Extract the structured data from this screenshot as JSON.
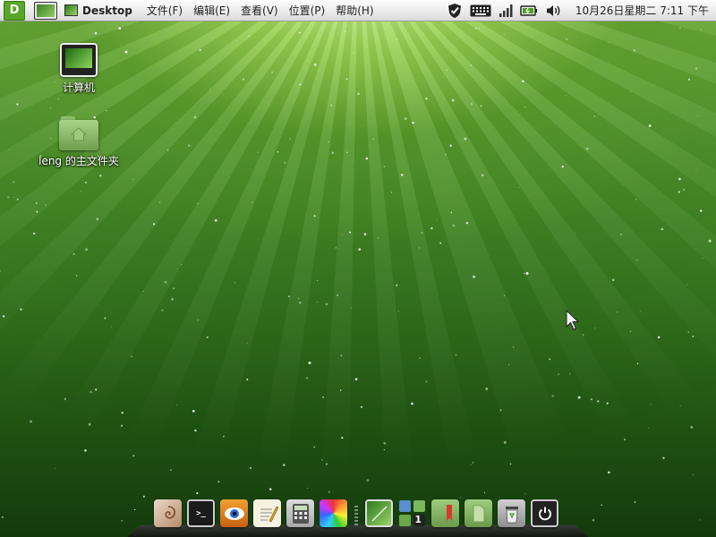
{
  "panel": {
    "logo_text": "D",
    "app_title": "Desktop",
    "menu": [
      {
        "label": "文件(F)"
      },
      {
        "label": "编辑(E)"
      },
      {
        "label": "查看(V)"
      },
      {
        "label": "位置(P)"
      },
      {
        "label": "帮助(H)"
      }
    ],
    "tray_icons": [
      "security-shield-icon",
      "keyboard-icon",
      "network-signal-icon",
      "battery-icon",
      "volume-icon"
    ],
    "clock": "10月26日星期二  7:11 下午"
  },
  "desktop": {
    "icons": [
      {
        "label": "计算机",
        "icon": "computer-icon"
      },
      {
        "label": "leng 的主文件夹",
        "icon": "home-folder-icon"
      }
    ]
  },
  "dock": {
    "items": [
      "nautilus-shell-icon",
      "terminal-icon",
      "eye-viewer-icon",
      "text-editor-icon",
      "calculator-icon",
      "color-picker-icon",
      "screenshot-icon",
      "workspace-switcher-icon",
      "bookmark-folder-icon",
      "documents-folder-icon",
      "trash-icon",
      "power-icon"
    ],
    "workspace_number": "1",
    "terminal_prompt": ">_"
  },
  "colors": {
    "accent": "#5aa628",
    "panel": "#e8e8e8"
  }
}
